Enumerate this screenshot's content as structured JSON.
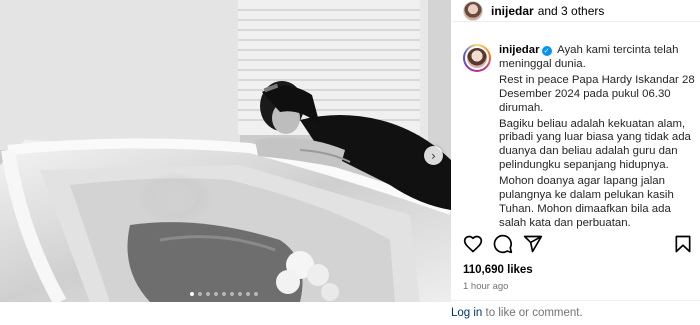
{
  "post": {
    "slide_count": 9,
    "active_slide": 1
  },
  "header": {
    "username": "inijedar",
    "collaborators": "and 3 others"
  },
  "caption": {
    "username": "inijedar",
    "paragraphs": [
      "Ayah kami tercinta telah meninggal dunia.",
      "Rest in peace Papa Hardy Iskandar 28 Desember 2024 pada pukul 06.30 dirumah.",
      "Bagiku beliau adalah kekuatan alam, pribadi yang luar biasa yang tidak ada duanya dan beliau adalah guru dan pelindungku sepanjang hidupnya.",
      "Mohon doanya agar lapang jalan pulangnya ke dalam pelukan kasih Tuhan. Mohon dimaafkan bila ada salah kata dan perbuatan."
    ]
  },
  "actions": {
    "like_icon": "heart-icon",
    "comment_icon": "comment-icon",
    "share_icon": "share-icon",
    "save_icon": "bookmark-icon"
  },
  "likes": "110,690 likes",
  "time": "1 hour ago",
  "footer": {
    "login_link": "Log in",
    "rest": "to like or comment."
  },
  "colors": {
    "link": "#00376b",
    "verified": "#0095f6",
    "muted": "#737373"
  }
}
